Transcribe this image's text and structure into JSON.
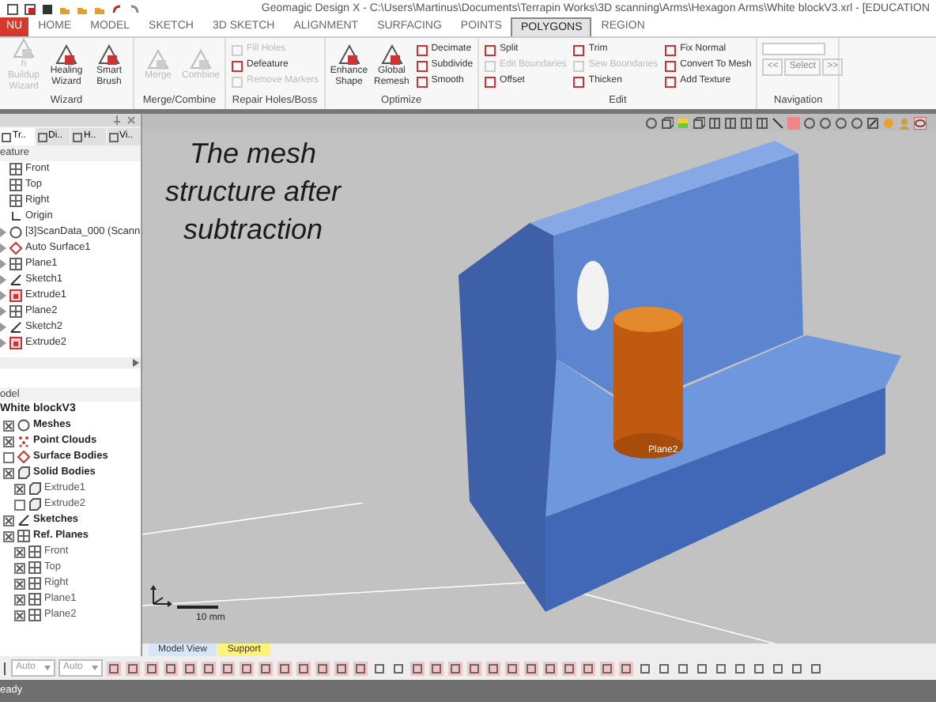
{
  "title_bar": {
    "title": "Geomagic Design X - C:\\Users\\Martinus\\Documents\\Terrapin Works\\3D scanning\\Arms\\Hexagon Arms\\White blockV3.xrl - [EDUCATION"
  },
  "menu_button": {
    "label": "NU"
  },
  "ribbon_tabs": [
    {
      "label": "HOME",
      "kind": "tab",
      "selected": false
    },
    {
      "label": "MODEL",
      "kind": "tab",
      "selected": false
    },
    {
      "label": "SKETCH",
      "kind": "tab",
      "selected": false
    },
    {
      "label": "3D SKETCH",
      "kind": "tab",
      "selected": false
    },
    {
      "label": "ALIGNMENT",
      "kind": "tab",
      "selected": false
    },
    {
      "label": "SURFACING",
      "kind": "tab",
      "selected": false
    },
    {
      "label": "POINTS",
      "kind": "tab",
      "selected": false
    },
    {
      "label": "POLYGONS",
      "kind": "tab",
      "selected": true
    },
    {
      "label": "REGION",
      "kind": "tab",
      "selected": false
    }
  ],
  "ribbon_groups": [
    {
      "title": "Wizard",
      "items": [
        {
          "label": "h Buildup Wizard",
          "kind": "large",
          "disabled": true
        },
        {
          "label": "Healing Wizard",
          "kind": "large",
          "disabled": false
        },
        {
          "label": "Smart Brush",
          "kind": "large",
          "disabled": false
        }
      ]
    },
    {
      "title": "Merge/Combine",
      "items": [
        {
          "label": "Merge",
          "kind": "large",
          "disabled": true
        },
        {
          "label": "Combine",
          "kind": "large",
          "disabled": true
        }
      ]
    },
    {
      "title": "Repair Holes/Boss",
      "items": [
        {
          "label": "Fill Holes",
          "kind": "small",
          "disabled": true
        },
        {
          "label": "Defeature",
          "kind": "small",
          "disabled": false
        },
        {
          "label": "Remove Markers",
          "kind": "small",
          "disabled": true
        }
      ]
    },
    {
      "title": "Optimize",
      "items": [
        {
          "label": "Enhance Shape",
          "kind": "large",
          "disabled": false
        },
        {
          "label": "Global Remesh",
          "kind": "large",
          "disabled": false
        },
        {
          "label": "Decimate",
          "kind": "small",
          "disabled": false
        },
        {
          "label": "Subdivide",
          "kind": "small",
          "disabled": false
        },
        {
          "label": "Smooth",
          "kind": "small",
          "disabled": false
        }
      ]
    },
    {
      "title": "Edit",
      "items": [
        {
          "label": "Split",
          "kind": "small",
          "disabled": false
        },
        {
          "label": "Edit Boundaries",
          "kind": "small",
          "disabled": true
        },
        {
          "label": "Offset",
          "kind": "small",
          "disabled": false
        },
        {
          "label": "Trim",
          "kind": "small",
          "disabled": false
        },
        {
          "label": "Sew Boundaries",
          "kind": "small",
          "disabled": true
        },
        {
          "label": "Thicken",
          "kind": "small",
          "disabled": false
        },
        {
          "label": "Fix Normal",
          "kind": "small",
          "disabled": false
        },
        {
          "label": "Convert To Mesh",
          "kind": "small",
          "disabled": false
        },
        {
          "label": "Add Texture",
          "kind": "small",
          "disabled": false
        }
      ]
    },
    {
      "title": "Navigation",
      "items": [
        {
          "label": "<<",
          "kind": "nav",
          "disabled": true
        },
        {
          "label": "Select",
          "kind": "nav",
          "disabled": true
        },
        {
          "label": ">>",
          "kind": "nav",
          "disabled": true
        }
      ]
    }
  ],
  "feature_panel": {
    "tabs": [
      {
        "label": "Tr..",
        "selected": true
      },
      {
        "label": "Di..",
        "selected": false
      },
      {
        "label": "H..",
        "selected": false
      },
      {
        "label": "Vi..",
        "selected": false
      }
    ],
    "header": "eature",
    "items": [
      {
        "label": "Front",
        "kind": "plane",
        "expandable": false
      },
      {
        "label": "Top",
        "kind": "plane",
        "expandable": false
      },
      {
        "label": "Right",
        "kind": "plane",
        "expandable": false
      },
      {
        "label": "Origin",
        "kind": "origin",
        "expandable": false
      },
      {
        "label": "[3]ScanData_000 (Scann",
        "kind": "scan",
        "expandable": true
      },
      {
        "label": "Auto Surface1",
        "kind": "surface",
        "expandable": true
      },
      {
        "label": "Plane1",
        "kind": "plane",
        "expandable": true
      },
      {
        "label": "Sketch1",
        "kind": "sketch",
        "expandable": true
      },
      {
        "label": "Extrude1",
        "kind": "extrude",
        "expandable": true
      },
      {
        "label": "Plane2",
        "kind": "plane",
        "expandable": true
      },
      {
        "label": "Sketch2",
        "kind": "sketch",
        "expandable": true
      },
      {
        "label": "Extrude2",
        "kind": "extrude",
        "expandable": true
      }
    ]
  },
  "model_panel": {
    "header": "odel",
    "root": "White blockV3",
    "items": [
      {
        "label": "Meshes",
        "kind": "mesh",
        "checked": true
      },
      {
        "label": "Point Clouds",
        "kind": "points",
        "checked": true
      },
      {
        "label": "Surface Bodies",
        "kind": "surface",
        "checked": false
      },
      {
        "label": "Solid Bodies",
        "kind": "solid",
        "checked": true,
        "children": [
          {
            "label": "Extrude1",
            "kind": "solid",
            "checked": true
          },
          {
            "label": "Extrude2",
            "kind": "solid",
            "checked": false
          }
        ]
      },
      {
        "label": "Sketches",
        "kind": "sketch",
        "checked": true
      },
      {
        "label": "Ref. Planes",
        "kind": "plane",
        "checked": true,
        "children": [
          {
            "label": "Front",
            "kind": "plane",
            "checked": true
          },
          {
            "label": "Top",
            "kind": "plane",
            "checked": true
          },
          {
            "label": "Right",
            "kind": "plane",
            "checked": true
          },
          {
            "label": "Plane1",
            "kind": "plane",
            "checked": true
          },
          {
            "label": "Plane2",
            "kind": "plane",
            "checked": true
          }
        ]
      }
    ]
  },
  "viewport": {
    "caption": "The mesh structure after subtraction",
    "plane_label": "Plane2",
    "scale_label": "10 mm"
  },
  "view_tabs": [
    {
      "label": "Model View",
      "selected": true
    },
    {
      "label": "Support",
      "selected": false
    }
  ],
  "bottom_dropdowns": [
    "Auto",
    "Auto"
  ],
  "status_bar": {
    "text": "eady"
  }
}
